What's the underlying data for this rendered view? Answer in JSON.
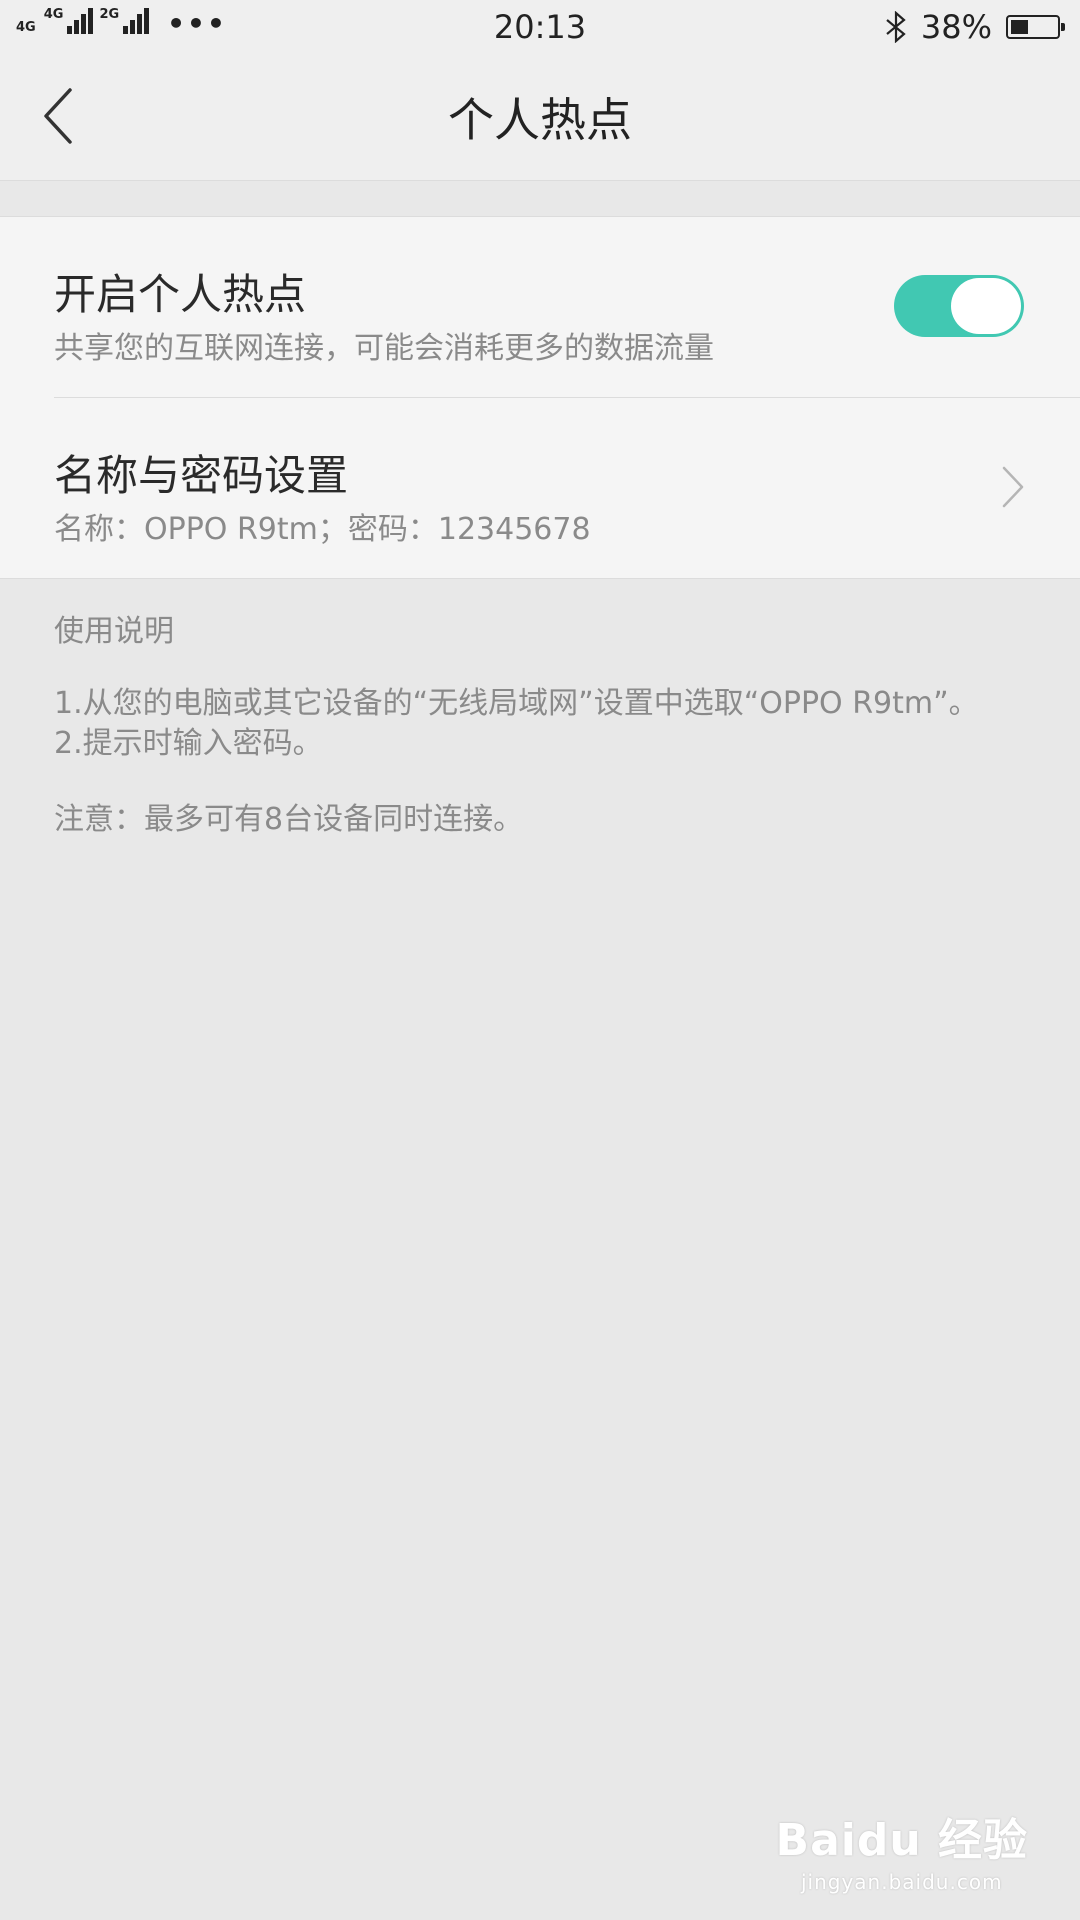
{
  "status_bar": {
    "sim1_label": "4G",
    "sim1b_label": "4G",
    "sim2_label": "2G",
    "more": "•••",
    "time": "20:13",
    "bluetooth_icon": "bluetooth-icon",
    "battery_percent": "38%",
    "battery_level": 0.38
  },
  "header": {
    "title": "个人热点",
    "back_icon": "chevron-left-icon"
  },
  "settings": {
    "hotspot": {
      "title": "开启个人热点",
      "subtitle": "共享您的互联网连接，可能会消耗更多的数据流量",
      "enabled": true,
      "toggle_color": "#41c8b2"
    },
    "name_password": {
      "title": "名称与密码设置",
      "subtitle": "名称：OPPO R9tm；密码：12345678"
    }
  },
  "instructions": {
    "heading": "使用说明",
    "step1": "1.从您的电脑或其它设备的“无线局域网”设置中选取“OPPO R9tm”。",
    "step2": "2.提示时输入密码。",
    "note": "注意：最多可有8台设备同时连接。"
  },
  "watermark": {
    "logo": "Baidu 经验",
    "url": "jingyan.baidu.com"
  }
}
